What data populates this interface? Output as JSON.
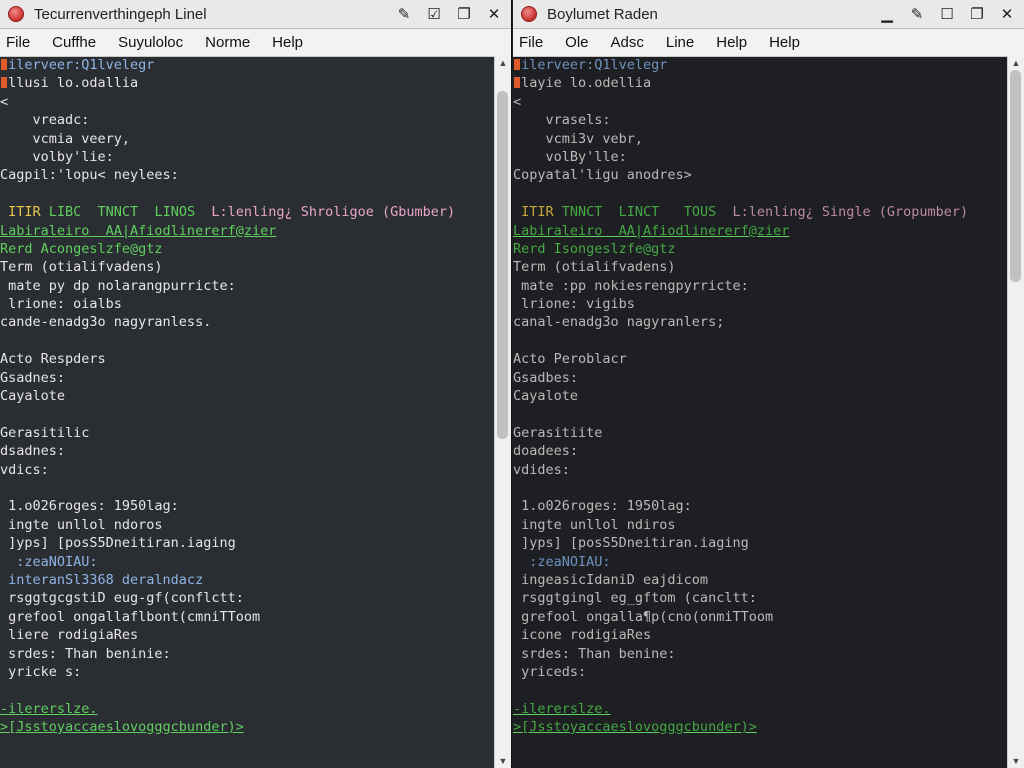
{
  "left": {
    "title": "Tecurrenverthingeph Linel",
    "menu": [
      "File",
      "Cuffhe",
      "Suyuloloc",
      "Norme",
      "Help"
    ],
    "lines": [
      {
        "text": "ilerveer:Q1lvelegr",
        "cls": "c-blue",
        "mark": true
      },
      {
        "text": "llusi lo.odallia",
        "cls": "",
        "mark": true
      },
      {
        "text": "<",
        "cls": ""
      },
      {
        "text": "    vreadc:",
        "cls": ""
      },
      {
        "text": "    vcmia veery,",
        "cls": ""
      },
      {
        "text": "    volby'lie:",
        "cls": ""
      },
      {
        "text": "Cagpil:'lopu< neylees:",
        "cls": ""
      },
      {
        "text": "",
        "cls": ""
      },
      {
        "segments": [
          {
            "t": "ITIR ",
            "cls": "c-yellow"
          },
          {
            "t": "LIBC  TNNCT  LINOS  ",
            "cls": "c-green"
          },
          {
            "t": "L:lenling¿ Shroligoe (Gbumber)",
            "cls": "c-pink"
          }
        ]
      },
      {
        "text": "Labiraleiro  AA|Afiodlinererf@zier",
        "cls": "c-green c-ul"
      },
      {
        "text": "Rerd Acongeslzfe@gtz",
        "cls": "c-green"
      },
      {
        "text": "Term (otialifvadens)",
        "cls": ""
      },
      {
        "text": " mate py dp nolarangpurricte:",
        "cls": ""
      },
      {
        "text": " lrione: oialbs",
        "cls": ""
      },
      {
        "text": "cande-enadg3o nagyranless.",
        "cls": ""
      },
      {
        "text": "",
        "cls": ""
      },
      {
        "text": "Acto Respders",
        "cls": ""
      },
      {
        "text": "Gsadnes:",
        "cls": ""
      },
      {
        "text": "Cayalote",
        "cls": ""
      },
      {
        "text": "",
        "cls": ""
      },
      {
        "text": "Gerasitilic",
        "cls": ""
      },
      {
        "text": "dsadnes:",
        "cls": ""
      },
      {
        "text": "vdics:",
        "cls": ""
      },
      {
        "text": "",
        "cls": ""
      },
      {
        "text": " 1.o026roges: 1950lag:",
        "cls": ""
      },
      {
        "text": " ingte unllol ndoros",
        "cls": ""
      },
      {
        "text": " ]yps] [posS5Dneitiran.iaging",
        "cls": ""
      },
      {
        "text": "  :zeaNOIAU:",
        "cls": "c-blue"
      },
      {
        "text": " interanSl3368 deralndacz",
        "cls": "c-blue"
      },
      {
        "text": " rsggtgcgstiD eug-gf(conflctt:",
        "cls": ""
      },
      {
        "text": " grefool ongallaflbont(cmniTToom",
        "cls": ""
      },
      {
        "text": " liere rodigiaRes",
        "cls": ""
      },
      {
        "text": " srdes: Than beninie:",
        "cls": ""
      },
      {
        "text": " yricke s:",
        "cls": ""
      },
      {
        "text": "",
        "cls": ""
      },
      {
        "text": "-ilererslze.",
        "cls": "c-green c-ul"
      },
      {
        "text": ">[Jsstoyaccaeslovogggcbunder)>",
        "cls": "c-green c-ul"
      }
    ]
  },
  "right": {
    "title": "Boylumet Raden",
    "menu": [
      "File",
      "Ole",
      "Adsc",
      "Line",
      "Help",
      "Help"
    ],
    "lines": [
      {
        "text": "ilerveer:Q1lvelegr",
        "cls": "c-blue",
        "mark": true
      },
      {
        "text": "layie lo.odellia",
        "cls": "",
        "mark": true
      },
      {
        "text": "<",
        "cls": ""
      },
      {
        "text": "    vrasels:",
        "cls": ""
      },
      {
        "text": "    vcmi3v vebr,",
        "cls": ""
      },
      {
        "text": "    volBy'lle:",
        "cls": ""
      },
      {
        "text": "Copyatal'ligu anodres>",
        "cls": ""
      },
      {
        "text": "",
        "cls": ""
      },
      {
        "segments": [
          {
            "t": "ITIR ",
            "cls": "c-yellow"
          },
          {
            "t": "TNNCT  LINCT   TOUS  ",
            "cls": "c-green"
          },
          {
            "t": "L:lenling¿ Single (Gropumber)",
            "cls": "c-pink"
          }
        ]
      },
      {
        "text": "Labiraleiro  AA|Afiodlinererf@zier",
        "cls": "c-green c-ul"
      },
      {
        "text": "Rerd Isongeslzfe@gtz",
        "cls": "c-green"
      },
      {
        "text": "Term (otialifvadens)",
        "cls": ""
      },
      {
        "text": " mate :pp nokiesrengpyrricte:",
        "cls": ""
      },
      {
        "text": " lrione: vigibs",
        "cls": ""
      },
      {
        "text": "canal-enadg3o nagyranlers;",
        "cls": ""
      },
      {
        "text": "",
        "cls": ""
      },
      {
        "text": "Acto Peroblacr",
        "cls": ""
      },
      {
        "text": "Gsadbes:",
        "cls": ""
      },
      {
        "text": "Cayalote",
        "cls": ""
      },
      {
        "text": "",
        "cls": ""
      },
      {
        "text": "Gerasitiite",
        "cls": ""
      },
      {
        "text": "doadees:",
        "cls": ""
      },
      {
        "text": "vdides:",
        "cls": ""
      },
      {
        "text": "",
        "cls": ""
      },
      {
        "text": " 1.o026roges: 1950lag:",
        "cls": ""
      },
      {
        "text": " ingte unllol ndiros",
        "cls": ""
      },
      {
        "text": " ]yps] [posS5Dneitiran.iaging",
        "cls": ""
      },
      {
        "text": "  :zeaNOIAU:",
        "cls": "c-blue"
      },
      {
        "text": " ingeasicIdaniD eajdicom",
        "cls": ""
      },
      {
        "text": " rsggtgingl eg_gftom (cancltt:",
        "cls": ""
      },
      {
        "text": " grefool ongalla¶p(cno(onmiTToom",
        "cls": ""
      },
      {
        "text": " icone rodigiaRes",
        "cls": ""
      },
      {
        "text": " srdes: Than benine:",
        "cls": ""
      },
      {
        "text": " yriceds:",
        "cls": ""
      },
      {
        "text": "",
        "cls": ""
      },
      {
        "text": "-ilererslze.",
        "cls": "c-green c-ul"
      },
      {
        "text": ">[Jsstoyaccaeslovogggcbunder)>",
        "cls": "c-green c-ul"
      }
    ]
  },
  "icons": {
    "close": "close-dot-icon",
    "edit": "pencil-icon",
    "checkbox": "checkbox-icon",
    "restore": "restore-icon",
    "close_x": "x-icon",
    "minimize": "minimize-icon",
    "maximize": "maximize-icon"
  },
  "scroll": {
    "left_thumb_top": 0.03,
    "left_thumb_size": 0.51,
    "right_thumb_top": 0.0,
    "right_thumb_size": 0.31
  }
}
